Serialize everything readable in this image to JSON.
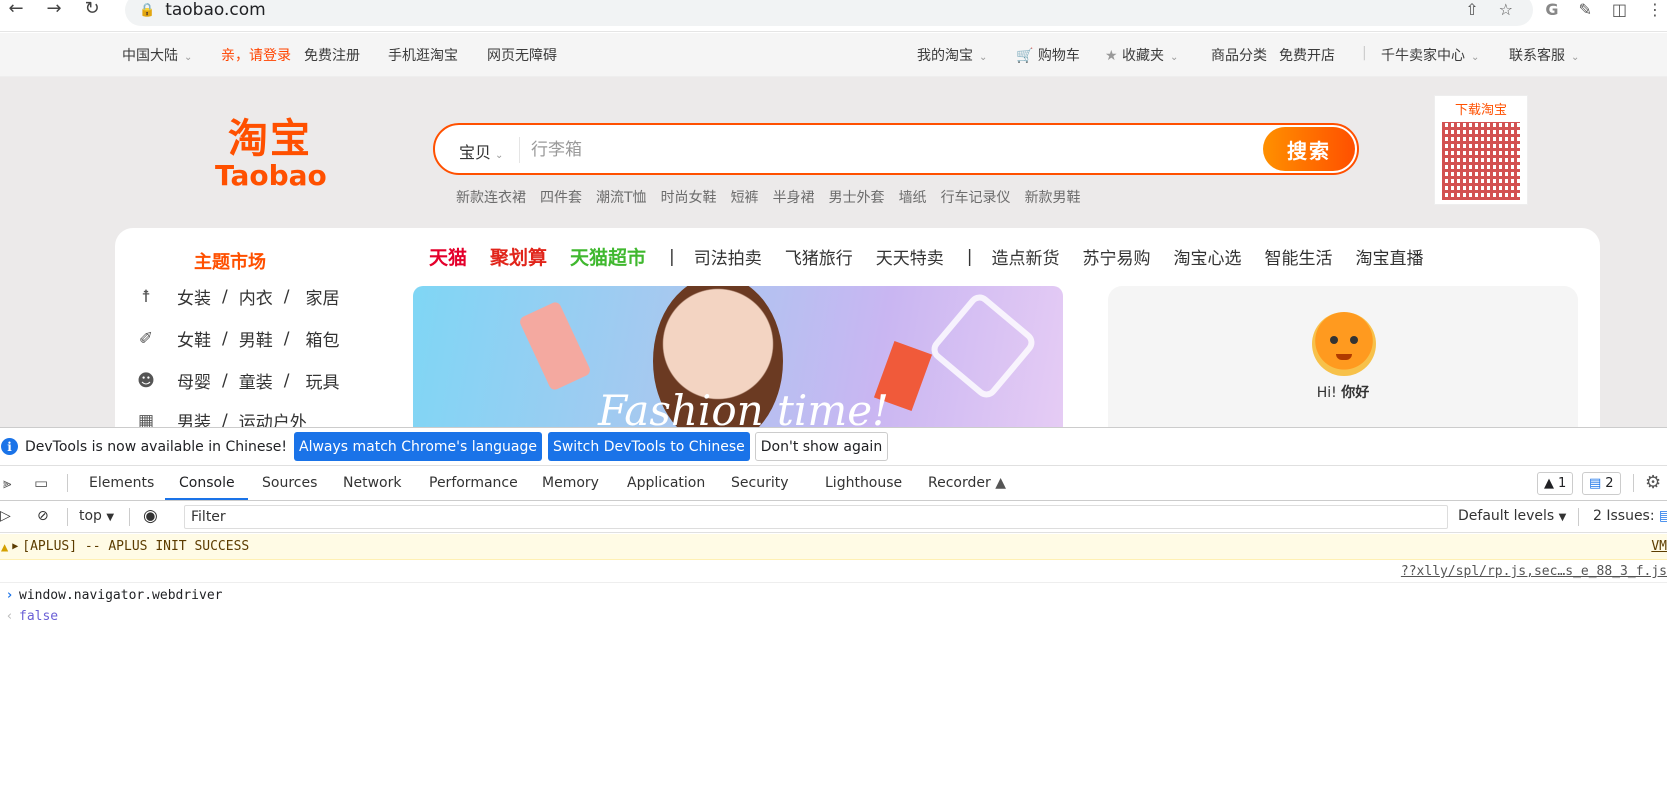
{
  "browser": {
    "url": "taobao.com"
  },
  "site_nav": {
    "region": "中国大陆",
    "login": "亲，请登录",
    "register": "免费注册",
    "mobile": "手机逛淘宝",
    "accessible": "网页无障碍",
    "my_taobao": "我的淘宝",
    "cart": "购物车",
    "favorites": "收藏夹",
    "categories": "商品分类",
    "open_shop": "免费开店",
    "seller_center": "千牛卖家中心",
    "support": "联系客服"
  },
  "logo": {
    "cn": "淘宝",
    "en": "Taobao"
  },
  "search": {
    "category": "宝贝",
    "placeholder": "行李箱",
    "button": "搜索",
    "hot_words": [
      "新款连衣裙",
      "四件套",
      "潮流T恤",
      "时尚女鞋",
      "短裤",
      "半身裙",
      "男士外套",
      "墙纸",
      "行车记录仪",
      "新款男鞋"
    ]
  },
  "qr": {
    "label": "下载淘宝"
  },
  "market": {
    "title": "主题市场",
    "rows": [
      [
        "女装",
        "内衣",
        "家居"
      ],
      [
        "女鞋",
        "男鞋",
        "箱包"
      ],
      [
        "母婴",
        "童装",
        "玩具"
      ],
      [
        "男装",
        "运动户外"
      ]
    ]
  },
  "channels": {
    "tmall": "天猫",
    "juhuasuan": "聚划算",
    "tmall_super": "天猫超市",
    "group1": [
      "司法拍卖",
      "飞猪旅行",
      "天天特卖"
    ],
    "group2": [
      "造点新货",
      "苏宁易购",
      "淘宝心选",
      "智能生活",
      "淘宝直播"
    ]
  },
  "banner": {
    "text": "Fashion time!"
  },
  "user": {
    "hi": "Hi!",
    "name": "你好"
  },
  "devtools": {
    "infobar": {
      "message": "DevTools is now available in Chinese!",
      "btn_match": "Always match Chrome's language",
      "btn_switch": "Switch DevTools to Chinese",
      "btn_dismiss": "Don't show again"
    },
    "tabs": [
      "Elements",
      "Console",
      "Sources",
      "Network",
      "Performance",
      "Memory",
      "Application",
      "Security",
      "Lighthouse",
      "Recorder"
    ],
    "active_tab": "Console",
    "warnings": "1",
    "messages": "2",
    "context": "top",
    "filter_placeholder": "Filter",
    "levels": "Default levels",
    "issues": "2 Issues:",
    "log": {
      "warning": "[APLUS] -- APLUS INIT SUCCESS",
      "warning_src": "VM",
      "source_link": "??xlly/spl/rp.js,sec…s_e_88_3_f.js",
      "input": "window.navigator.webdriver",
      "output": "false"
    }
  },
  "colors": {
    "brand": "#ff5000",
    "tmall": "#e4002b",
    "juhuasuan": "#e1251b",
    "tmall_super": "#40b82f",
    "devtools_blue": "#1a73e8"
  }
}
